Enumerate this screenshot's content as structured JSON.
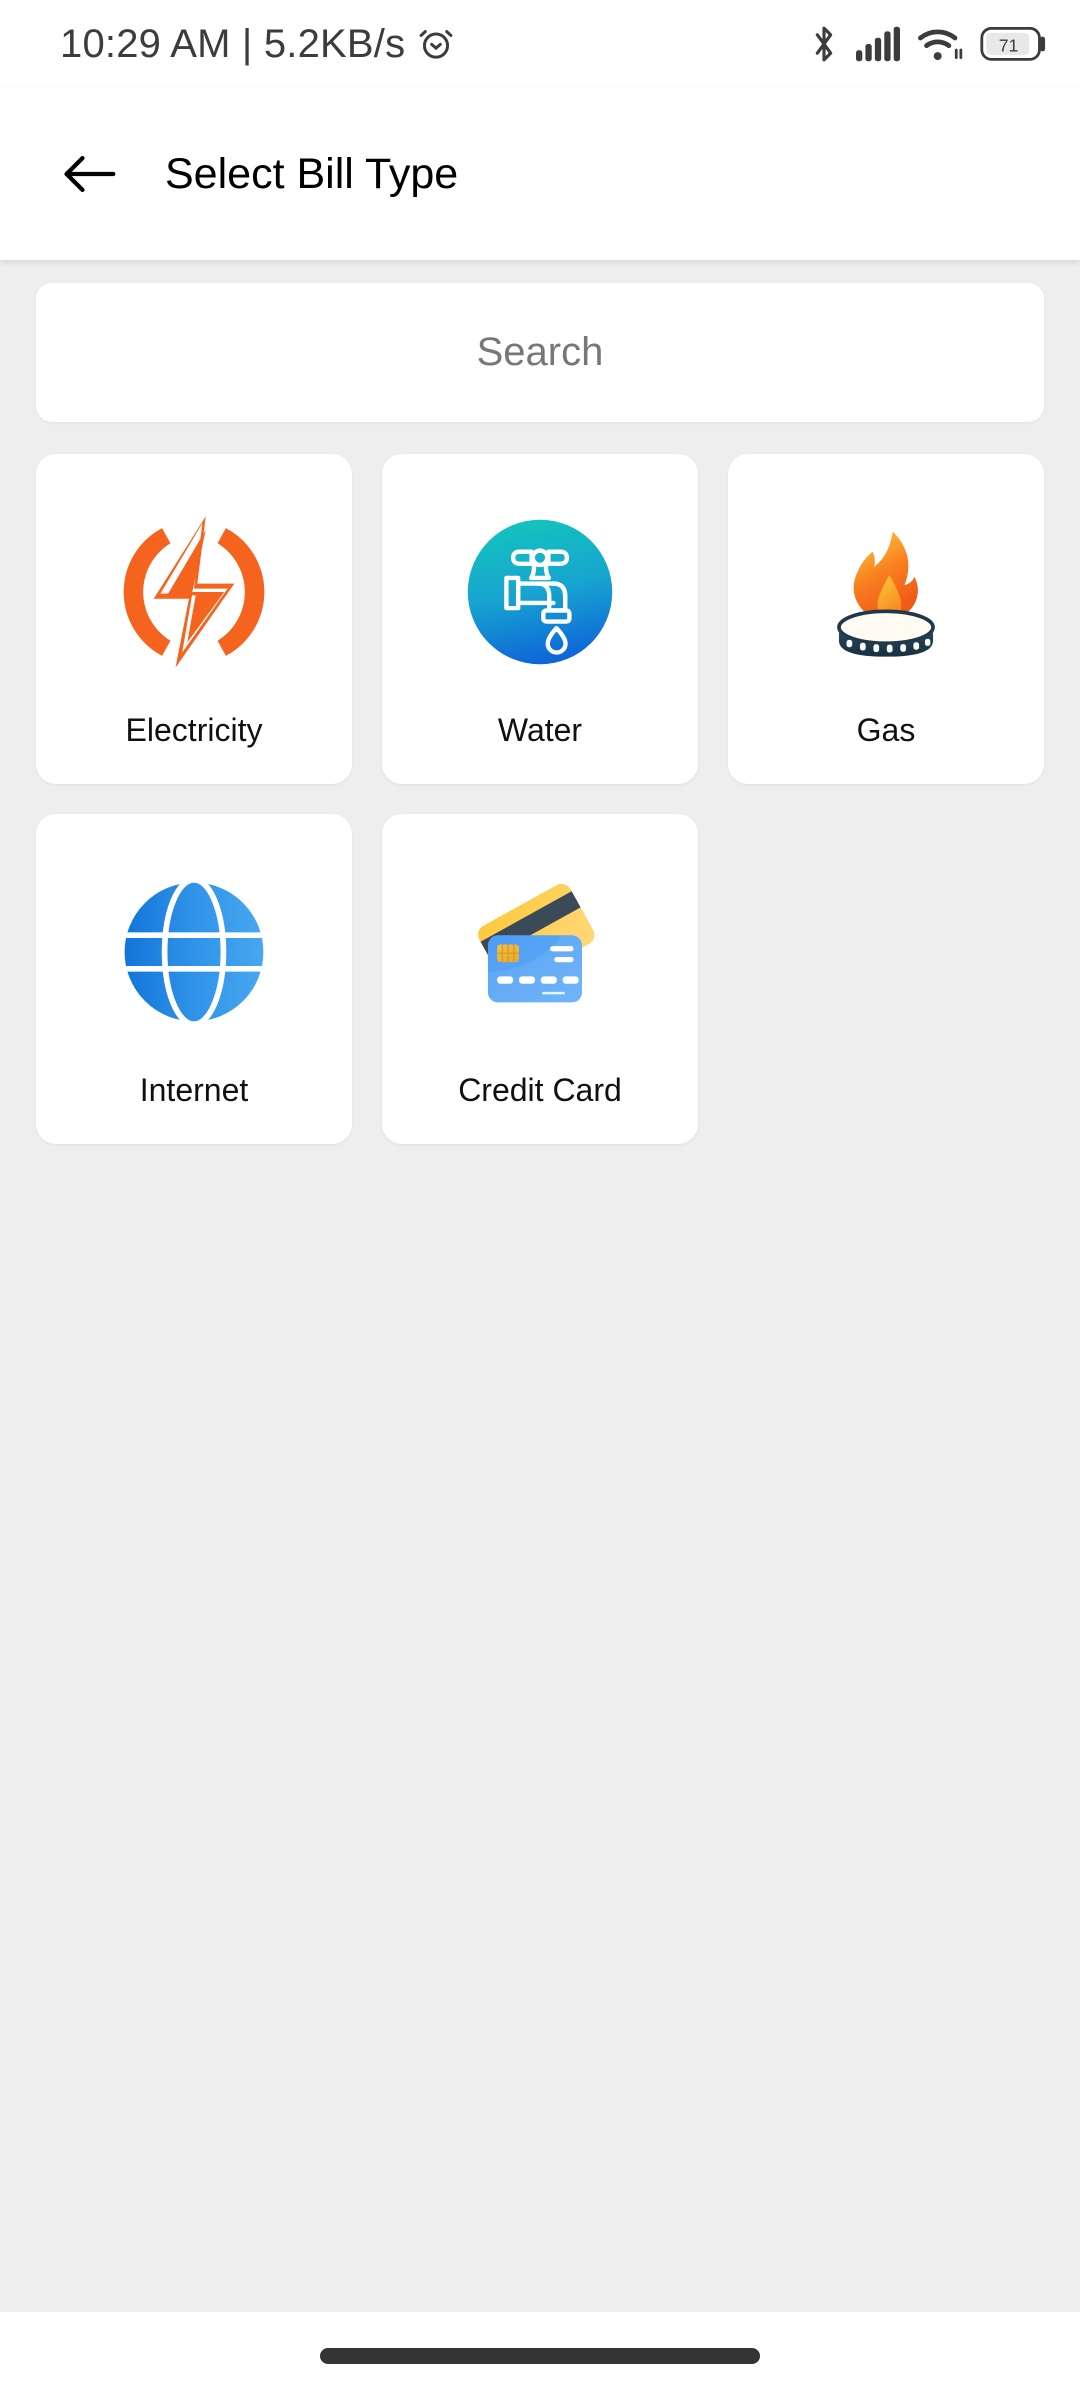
{
  "status_bar": {
    "time_text": "10:29 AM | 5.2KB/s",
    "alarm_icon": "alarm-clock-icon",
    "bluetooth_icon": "bluetooth-icon",
    "signal_icon": "cellular-signal-icon",
    "wifi_icon": "wifi-icon",
    "battery_icon": "battery-icon",
    "battery_level": "71",
    "text_color": "#3c3c3c"
  },
  "app_bar": {
    "back_icon": "back-arrow-icon",
    "title": "Select Bill Type",
    "background": "#ffffff",
    "title_color": "#000000"
  },
  "search": {
    "placeholder": "Search",
    "value": "",
    "background": "#ffffff",
    "placeholder_color": "#777777"
  },
  "bill_types": [
    {
      "label": "Electricity",
      "icon": "electricity-bolt-icon",
      "color": "#f4641e"
    },
    {
      "label": "Water",
      "icon": "water-faucet-icon",
      "color": "#1585d8"
    },
    {
      "label": "Gas",
      "icon": "gas-burner-flame-icon",
      "color": "#f47b20"
    },
    {
      "label": "Internet",
      "icon": "globe-icon",
      "color": "#2a8bec"
    },
    {
      "label": "Credit Card",
      "icon": "credit-card-icon",
      "color": "#5aa2f0"
    }
  ],
  "nav_bar": {
    "gesture_pill": "home-gesture-pill",
    "color": "#343434"
  },
  "theme": {
    "page_background": "#eeeeee",
    "card_background": "#ffffff"
  }
}
